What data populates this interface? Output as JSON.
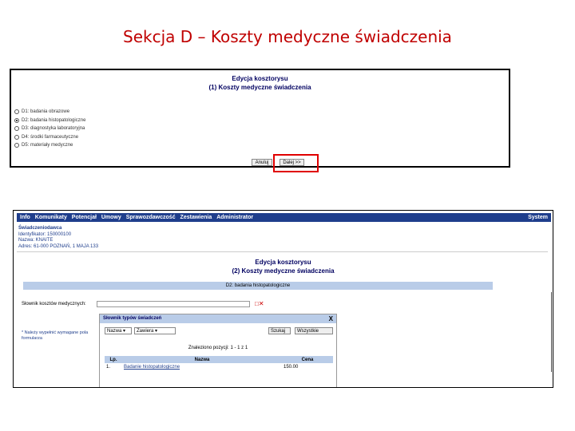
{
  "slide": {
    "title": "Sekcja D – Koszty medyczne świadczenia"
  },
  "panel1": {
    "title1": "Edycja kosztorysu",
    "title2": "(1) Koszty medyczne świadczenia",
    "options": [
      {
        "code": "D1:",
        "label": "badania obrazowe",
        "checked": false
      },
      {
        "code": "D2:",
        "label": "badania histopatologiczne",
        "checked": true
      },
      {
        "code": "D3:",
        "label": "diagnostyka laboratoryjna",
        "checked": false
      },
      {
        "code": "D4:",
        "label": "środki farmaceutyczne",
        "checked": false
      },
      {
        "code": "D5:",
        "label": "materiały medyczne",
        "checked": false
      }
    ],
    "cancel_label": "Anuluj",
    "next_label": "Dalej >>"
  },
  "panel2": {
    "menu": [
      "Info",
      "Komunikaty",
      "Potencjał",
      "Umowy",
      "Sprawozdawczość",
      "Zestawienia",
      "Administrator"
    ],
    "menu_system": "System",
    "provider_label": "Świadczeniodawca",
    "ident": "Identyfikator: 150000100",
    "name": "Nazwa: KNAITE",
    "address": "Adres: 61-000 POZNAŃ, 1 MAJA 133",
    "title1": "Edycja kosztorysu",
    "title2": "(2) Koszty medyczne świadczenia",
    "bar_label": "D2: badania histopatologiczne",
    "slownik_label": "Słownik kosztów medycznych:",
    "slownik_icons": "□✕",
    "note1": "* Należy wypełnić wymagane pola",
    "note2": "formularza"
  },
  "popup": {
    "title": "Słownik typów świadczeń",
    "close": "X",
    "select_field": "Nazwa",
    "select_mode": "Zawiera",
    "search_label": "Szukaj",
    "all_label": "Wszystkie",
    "found_text": "Znaleziono pozycji: 1 - 1 z 1",
    "columns": [
      "Lp.",
      "Nazwa",
      "Cena"
    ],
    "rows": [
      {
        "lp": "1.",
        "nazwa": "Badanie histopatologiczne",
        "cena": "150.00"
      }
    ]
  }
}
